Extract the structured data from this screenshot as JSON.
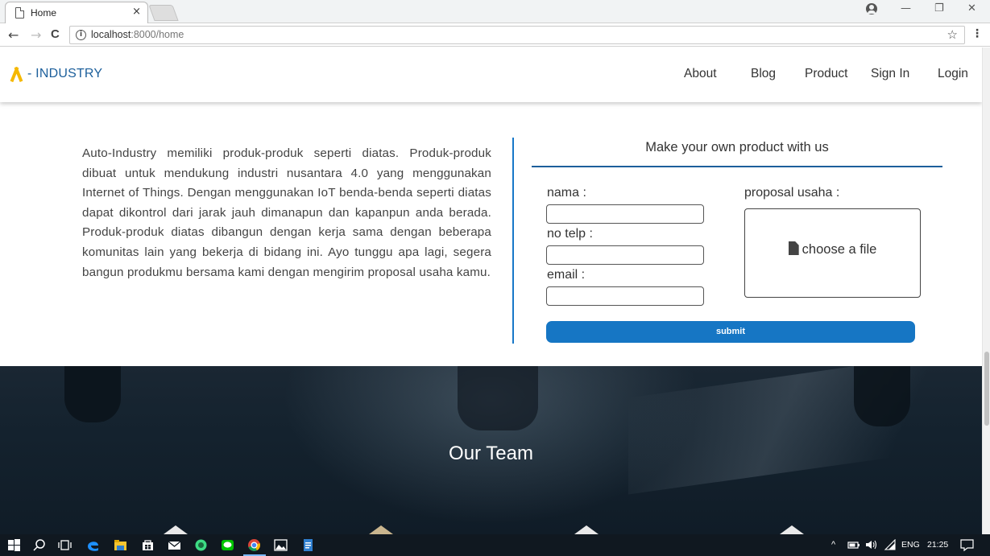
{
  "browser": {
    "tab_title": "Home",
    "tab_close": "×",
    "url_host": "localhost",
    "url_rest": ":8000/home",
    "back": "←",
    "forward": "→",
    "reload": "C",
    "star": "☆",
    "menu": "⋮",
    "minimize": "—",
    "restore": "❐",
    "close": "✕",
    "info": "i"
  },
  "site": {
    "logo_text": "- INDUSTRY",
    "nav": [
      "About",
      "Blog",
      "Product",
      "Sign In",
      "Login"
    ]
  },
  "about": {
    "paragraph": "Auto-Industry memiliki produk-produk seperti diatas. Produk-produk dibuat untuk mendukung industri nusantara 4.0 yang menggunakan Internet of Things. Dengan menggunakan IoT benda-benda seperti diatas dapat dikontrol dari jarak jauh dimanapun dan kapanpun anda berada. Produk-produk diatas dibangun dengan kerja sama dengan beberapa komunitas lain yang bekerja di bidang ini. Ayo tunggu apa lagi, segera bangun produkmu bersama kami dengan mengirim proposal usaha kamu."
  },
  "form": {
    "title": "Make your own product with us",
    "nama_label": "nama :",
    "telp_label": "no telp :",
    "email_label": "email :",
    "proposal_label": "proposal usaha :",
    "file_label": "choose a file",
    "submit_label": "submit",
    "nama_value": "",
    "telp_value": "",
    "email_value": ""
  },
  "team": {
    "title": "Our Team"
  },
  "taskbar": {
    "language": "ENG",
    "time": "21:25"
  },
  "colors": {
    "accent": "#1676c4",
    "brand_blue": "#1c5f9b",
    "logo_yellow": "#f5b800",
    "team_bg": "#14222e"
  }
}
